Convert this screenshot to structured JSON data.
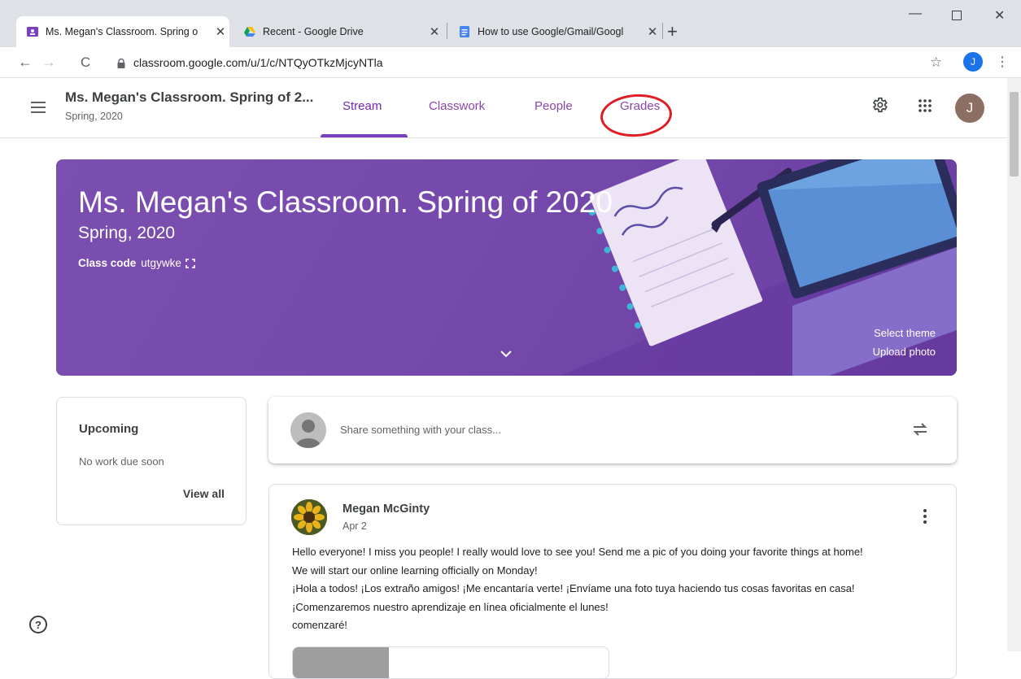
{
  "browser": {
    "tabs": [
      {
        "title": "Ms. Megan's Classroom. Spring o",
        "favicon": "classroom-icon",
        "active": true
      },
      {
        "title": "Recent - Google Drive",
        "favicon": "drive-icon",
        "active": false
      },
      {
        "title": "How to use Google/Gmail/Googl",
        "favicon": "docs-icon",
        "active": false
      }
    ],
    "close_glyph": "✕",
    "new_tab_glyph": "+",
    "url": "classroom.google.com/u/1/c/NTQyOTkzMjcyNTla",
    "profile_initial": "J"
  },
  "header": {
    "class_title": "Ms. Megan's Classroom. Spring of 2...",
    "class_subtitle": "Spring, 2020",
    "tabs": [
      {
        "label": "Stream",
        "active": true
      },
      {
        "label": "Classwork",
        "active": false
      },
      {
        "label": "People",
        "active": false
      },
      {
        "label": "Grades",
        "active": false
      }
    ],
    "avatar_initial": "J"
  },
  "banner": {
    "title": "Ms. Megan's Classroom. Spring of 2020",
    "subtitle": "Spring, 2020",
    "class_code_label": "Class code",
    "class_code": "utgywke",
    "select_theme": "Select theme",
    "upload_photo": "Upload photo"
  },
  "upcoming": {
    "heading": "Upcoming",
    "status": "No work due soon",
    "view_all": "View all"
  },
  "share": {
    "placeholder": "Share something with your class..."
  },
  "post": {
    "author": "Megan McGinty",
    "date": "Apr 2",
    "lines": [
      "Hello everyone! I miss you people! I really would love to see you! Send me a pic of you doing your favorite things at home!",
      "We will start our online learning officially on Monday!",
      "¡Hola a todos! ¡Los extraño amigos! ¡Me encantaría verte! ¡Envíame una foto tuya haciendo tus cosas favoritas en casa!",
      "¡Comenzaremos nuestro aprendizaje en línea oficialmente el lunes!",
      "comenzaré!"
    ]
  },
  "help": {
    "glyph": "?"
  },
  "colors": {
    "accent": "#7b3fbe",
    "banner": "#7549ab",
    "annotation": "#e01b24"
  }
}
